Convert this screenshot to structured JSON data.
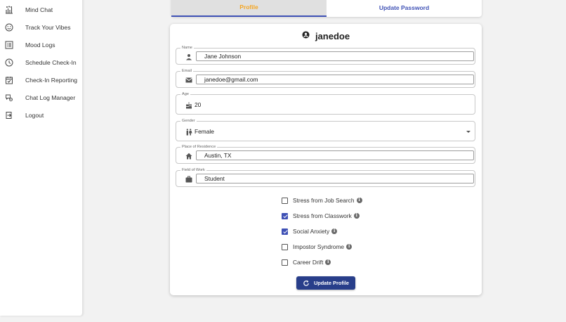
{
  "sidebar": {
    "items": [
      {
        "label": "Mind Chat",
        "icon": "brain-chat-icon"
      },
      {
        "label": "Track Your Vibes",
        "icon": "smiley-icon"
      },
      {
        "label": "Mood Logs",
        "icon": "list-icon"
      },
      {
        "label": "Schedule Check-In",
        "icon": "clock-icon"
      },
      {
        "label": "Check-In Reporting",
        "icon": "calendar-check-icon"
      },
      {
        "label": "Chat Log Manager",
        "icon": "chat-settings-icon"
      },
      {
        "label": "Logout",
        "icon": "logout-icon"
      }
    ]
  },
  "tabs": {
    "profile": "Profile",
    "update_password": "Update Password",
    "active": "profile"
  },
  "profile": {
    "username": "janedoe",
    "name": {
      "label": "Name",
      "value": "Jane Johnson"
    },
    "email": {
      "label": "Email",
      "value": "janedoe@gmail.com"
    },
    "age": {
      "label": "Age",
      "value": "20"
    },
    "gender": {
      "label": "Gender",
      "value": "Female"
    },
    "residence": {
      "label": "Place of Residence",
      "value": "Austin, TX"
    },
    "work": {
      "label": "Field of Work",
      "value": "Student"
    }
  },
  "concerns": [
    {
      "label": "Stress from Job Search",
      "checked": false
    },
    {
      "label": "Stress from Classwork",
      "checked": true
    },
    {
      "label": "Social Anxiety",
      "checked": true
    },
    {
      "label": "Impostor Syndrome",
      "checked": false
    },
    {
      "label": "Career Drift",
      "checked": false
    }
  ],
  "actions": {
    "update_profile": "Update Profile"
  },
  "colors": {
    "accent": "#3f51b5",
    "button": "#283e8a",
    "active_tab_text": "#f5a623"
  }
}
